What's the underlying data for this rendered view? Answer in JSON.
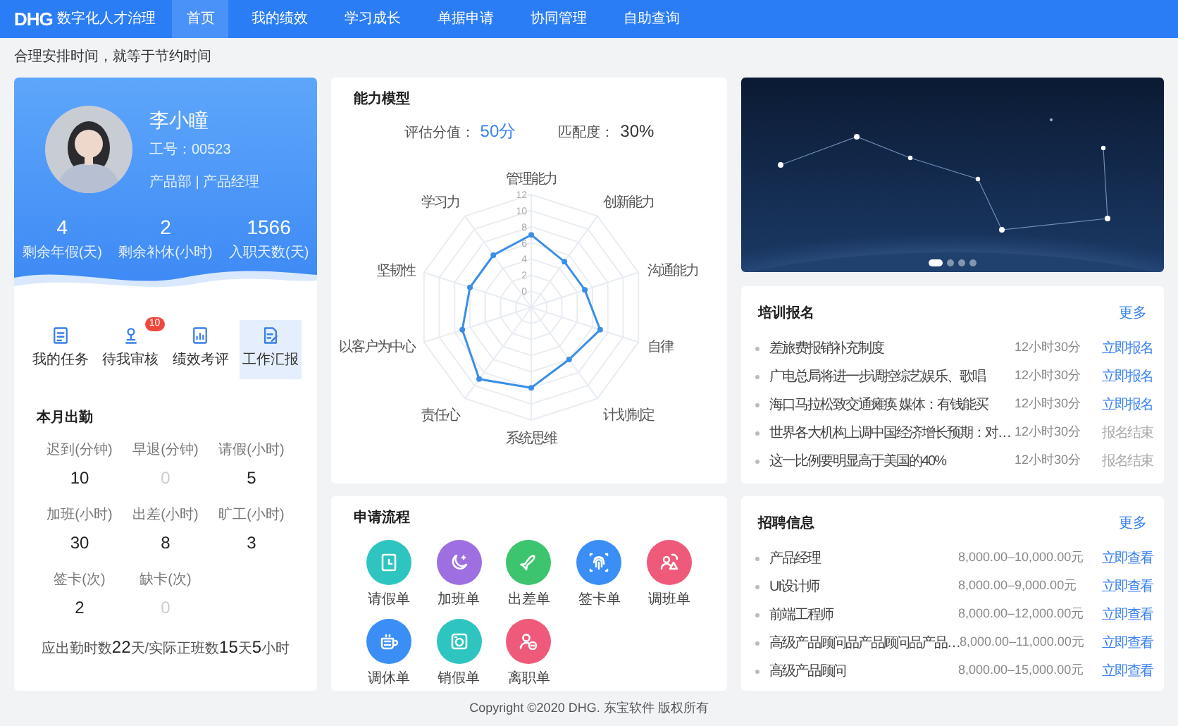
{
  "nav": {
    "logo": "DHG",
    "app_name": "数字化人才治理",
    "items": [
      {
        "label": "首页",
        "selected": true
      },
      {
        "label": "我的绩效",
        "selected": false
      },
      {
        "label": "学习成长",
        "selected": false
      },
      {
        "label": "单据申请",
        "selected": false
      },
      {
        "label": "协同管理",
        "selected": false
      },
      {
        "label": "自助查询",
        "selected": false
      }
    ]
  },
  "tagline": "合理安排时间，就等于节约时间",
  "profile": {
    "name": "李小瞳",
    "employee_no": "工号：00523",
    "department": "产品部 | 产品经理",
    "stats": [
      {
        "value": "4",
        "label": "剩余年假(天)"
      },
      {
        "value": "2",
        "label": "剩余补休(小时)"
      },
      {
        "value": "1566",
        "label": "入职天数(天)"
      }
    ]
  },
  "quick_actions": [
    {
      "label": "我的任务",
      "selected": false
    },
    {
      "label": "待我审核",
      "badge": "10",
      "selected": false
    },
    {
      "label": "绩效考评",
      "selected": false
    },
    {
      "label": "工作汇报",
      "selected": true
    }
  ],
  "attendance": {
    "title": "本月出勤",
    "items": [
      {
        "label": "迟到(分钟)",
        "value": "10",
        "dim": false
      },
      {
        "label": "早退(分钟)",
        "value": "0",
        "dim": true
      },
      {
        "label": "请假(小时)",
        "value": "5",
        "dim": false
      },
      {
        "label": "加班(小时)",
        "value": "30",
        "dim": false
      },
      {
        "label": "出差(小时)",
        "value": "8",
        "dim": false
      },
      {
        "label": "旷工(小时)",
        "value": "3",
        "dim": false
      },
      {
        "label": "签卡(次)",
        "value": "2",
        "dim": false
      },
      {
        "label": "缺卡(次)",
        "value": "0",
        "dim": true
      }
    ],
    "summary": "应出勤时数**22**天/实际正班数**15**天**5**小时"
  },
  "ability": {
    "title": "能力模型",
    "score_label": "评估分值：",
    "score": "50分",
    "match_label": "匹配度：",
    "match": "30%",
    "chart_data": {
      "type": "radar",
      "categories": [
        "管理能力",
        "创新能力",
        "沟通能力",
        "自律",
        "计划制定",
        "系统思维",
        "责任心",
        "以客户为中心",
        "坚韧性",
        "学习力"
      ],
      "series": [
        {
          "color": "#3a8ee6",
          "values": [
            7,
            5,
            5,
            7,
            6,
            8,
            9,
            7,
            6,
            6
          ]
        }
      ],
      "ylim": [
        -2,
        12
      ],
      "yticks": [
        0,
        2,
        4,
        6,
        8,
        10,
        12
      ]
    }
  },
  "apply": {
    "title": "申请流程",
    "items": [
      {
        "label": "请假单",
        "color": "#2ec4bf"
      },
      {
        "label": "加班单",
        "color": "#9d6fe0"
      },
      {
        "label": "出差单",
        "color": "#3cc46e"
      },
      {
        "label": "签卡单",
        "color": "#3a8ef5"
      },
      {
        "label": "调班单",
        "color": "#ef5a7a"
      },
      {
        "label": "调休单",
        "color": "#3a8ef5"
      },
      {
        "label": "销假单",
        "color": "#2ec4bf"
      },
      {
        "label": "离职单",
        "color": "#ef5a7a"
      }
    ]
  },
  "banner": {
    "kind": "picture",
    "carousel": [
      {
        "selected": true
      },
      {
        "selected": false
      },
      {
        "selected": false
      },
      {
        "selected": false
      }
    ]
  },
  "training": {
    "title": "培训报名",
    "more": "更多",
    "items": [
      {
        "title": "差旅费报销补充制度",
        "time": "12小时30分",
        "action": "立即报名",
        "open": true
      },
      {
        "title": "广电总局将进一步调控综艺娱乐、歌唱",
        "time": "12小时30分",
        "action": "立即报名",
        "open": true
      },
      {
        "title": "海口马拉松致交通瘫痪 媒体：有钱能买",
        "time": "12小时30分",
        "action": "立即报名",
        "open": true
      },
      {
        "title": "世界各大机构上调中国经济增长预期：对…",
        "time": "12小时30分",
        "action": "报名结束",
        "open": false
      },
      {
        "title": "这一比例要明显高于美国的40%",
        "time": "12小时30分",
        "action": "报名结束",
        "open": false
      }
    ]
  },
  "recruit": {
    "title": "招聘信息",
    "more": "更多",
    "items": [
      {
        "title": "产品经理",
        "salary": "8,000.00–10,000.00元",
        "action": "立即查看"
      },
      {
        "title": "UI设计师",
        "salary": "8,000.00–9,000.00元",
        "action": "立即查看"
      },
      {
        "title": "前端工程师",
        "salary": "8,000.00–12,000.00元",
        "action": "立即查看"
      },
      {
        "title": "高级产品顾问品产品顾问品产品…",
        "salary": "8,000.00–11,000.00元",
        "action": "立即查看"
      },
      {
        "title": "高级产品顾问",
        "salary": "8,000.00–15,000.00元",
        "action": "立即查看"
      }
    ]
  },
  "footer": "Copyright ©2020 DHG. 东宝软件 版权所有"
}
